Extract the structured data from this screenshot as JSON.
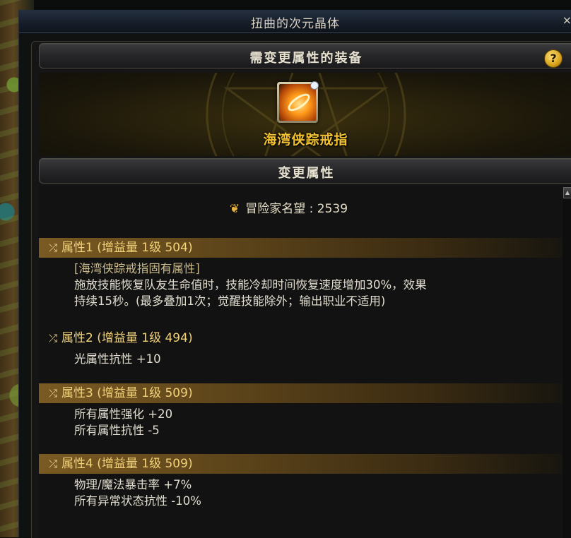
{
  "window": {
    "title": "扭曲的次元晶体",
    "close_label": "×"
  },
  "equipment_section": {
    "header": "需变更属性的装备",
    "help_label": "?",
    "item_name": "海湾侠踪戒指"
  },
  "change_section": {
    "header": "变更属性"
  },
  "renown": {
    "label": "冒险家名望 : 2539",
    "icon": "laurel-icon"
  },
  "attributes": [
    {
      "title": "属性1 (增益量 1级 504)",
      "highlighted": true,
      "lines": [
        "[海湾侠踪戒指固有属性]",
        "施放技能恢复队友生命值时，技能冷却时间恢复速度增加30%，效果",
        "持续15秒。(最多叠加1次；觉醒技能除外；输出职业不适用)"
      ]
    },
    {
      "title": "属性2 (增益量 1级 494)",
      "highlighted": false,
      "lines": [
        "光属性抗性 +10"
      ]
    },
    {
      "title": "属性3 (增益量 1级 509)",
      "highlighted": true,
      "lines": [
        "所有属性强化 +20",
        "所有属性抗性 -5"
      ]
    },
    {
      "title": "属性4 (增益量 1级 509)",
      "highlighted": true,
      "lines": [
        "物理/魔法暴击率 +7%",
        "所有异常状态抗性 -10%"
      ]
    }
  ],
  "colors": {
    "title_gold": "#f1d27a",
    "item_name": "#f2c230",
    "bar_brown": "#7a5a22"
  }
}
